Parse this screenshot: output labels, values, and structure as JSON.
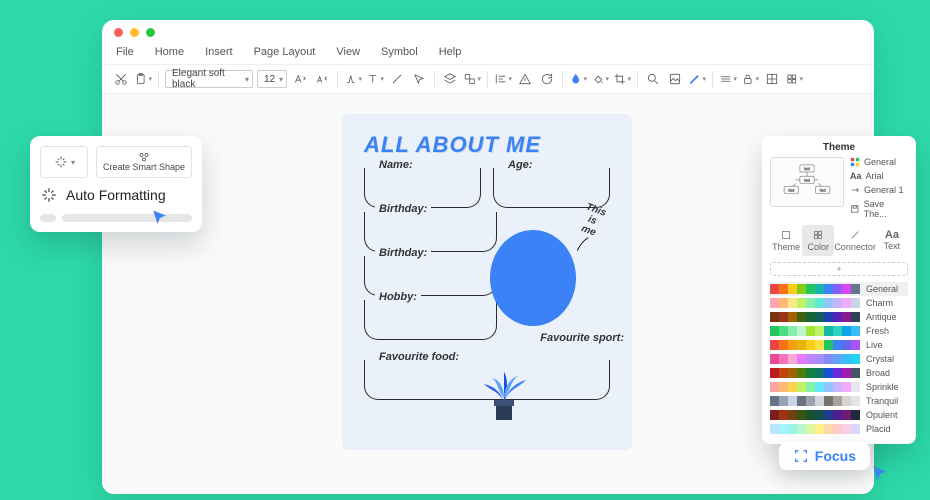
{
  "menu": {
    "file": "File",
    "home": "Home",
    "insert": "Insert",
    "page_layout": "Page Layout",
    "view": "View",
    "symbol": "Symbol",
    "help": "Help"
  },
  "toolbar": {
    "font": "Elegant soft black",
    "size": "12"
  },
  "doc": {
    "title": "ALL ABOUT ME",
    "name": "Name:",
    "age": "Age:",
    "birthday": "Birthday:",
    "birthday2": "Birthday:",
    "hobby": "Hobby:",
    "favfood": "Favourite food:",
    "favsport": "Favourite sport:",
    "thisisme": "This\nis\nme"
  },
  "popover": {
    "create_smart": "Create Smart Shape",
    "auto_formatting": "Auto Formatting"
  },
  "theme": {
    "title": "Theme",
    "opts": {
      "general": "General",
      "arial": "Arial",
      "general1": "General 1",
      "save": "Save The..."
    },
    "tabs": {
      "theme": "Theme",
      "color": "Color",
      "connector": "Connector",
      "text": "Text"
    },
    "plus": "+",
    "swatches": [
      {
        "name": "General",
        "sel": true,
        "c": [
          "#ef4444",
          "#f97316",
          "#facc15",
          "#84cc16",
          "#22c55e",
          "#14b8a6",
          "#3b82f6",
          "#8b5cf6",
          "#d946ef",
          "#64748b"
        ]
      },
      {
        "name": "Charm",
        "c": [
          "#fda4af",
          "#fdba74",
          "#fde68a",
          "#bef264",
          "#86efac",
          "#5eead4",
          "#93c5fd",
          "#c4b5fd",
          "#f0abfc",
          "#cbd5e1"
        ]
      },
      {
        "name": "Antique",
        "c": [
          "#78350f",
          "#9a3412",
          "#a16207",
          "#3f6212",
          "#166534",
          "#115e59",
          "#1e40af",
          "#5b21b6",
          "#86198f",
          "#334155"
        ]
      },
      {
        "name": "Fresh",
        "c": [
          "#22c55e",
          "#4ade80",
          "#86efac",
          "#bbf7d0",
          "#a3e635",
          "#bef264",
          "#14b8a6",
          "#2dd4bf",
          "#0ea5e9",
          "#38bdf8"
        ]
      },
      {
        "name": "Live",
        "c": [
          "#ef4444",
          "#f97316",
          "#f59e0b",
          "#eab308",
          "#facc15",
          "#fde047",
          "#22c55e",
          "#3b82f6",
          "#6366f1",
          "#a855f7"
        ]
      },
      {
        "name": "Crystal",
        "c": [
          "#ec4899",
          "#f472b6",
          "#f9a8d4",
          "#e879f9",
          "#c084fc",
          "#a78bfa",
          "#818cf8",
          "#60a5fa",
          "#38bdf8",
          "#22d3ee"
        ]
      },
      {
        "name": "Broad",
        "c": [
          "#b91c1c",
          "#c2410c",
          "#a16207",
          "#4d7c0f",
          "#15803d",
          "#0f766e",
          "#1d4ed8",
          "#6d28d9",
          "#a21caf",
          "#475569"
        ]
      },
      {
        "name": "Sprinkle",
        "c": [
          "#fca5a5",
          "#fdba74",
          "#fcd34d",
          "#bef264",
          "#86efac",
          "#67e8f9",
          "#93c5fd",
          "#c4b5fd",
          "#f0abfc",
          "#e5e7eb"
        ]
      },
      {
        "name": "Tranquil",
        "c": [
          "#64748b",
          "#94a3b8",
          "#cbd5e1",
          "#6b7280",
          "#9ca3af",
          "#d1d5db",
          "#78716c",
          "#a8a29e",
          "#d6d3d1",
          "#e7e5e4"
        ]
      },
      {
        "name": "Opulent",
        "c": [
          "#7f1d1d",
          "#9a3412",
          "#713f12",
          "#365314",
          "#14532d",
          "#134e4a",
          "#1e3a8a",
          "#4c1d95",
          "#701a75",
          "#1e293b"
        ]
      },
      {
        "name": "Placid",
        "c": [
          "#bae6fd",
          "#a5f3fc",
          "#99f6e4",
          "#bbf7d0",
          "#d9f99d",
          "#fef08a",
          "#fed7aa",
          "#fecaca",
          "#fbcfe8",
          "#ddd6fe"
        ]
      }
    ]
  },
  "focus": {
    "label": "Focus"
  }
}
